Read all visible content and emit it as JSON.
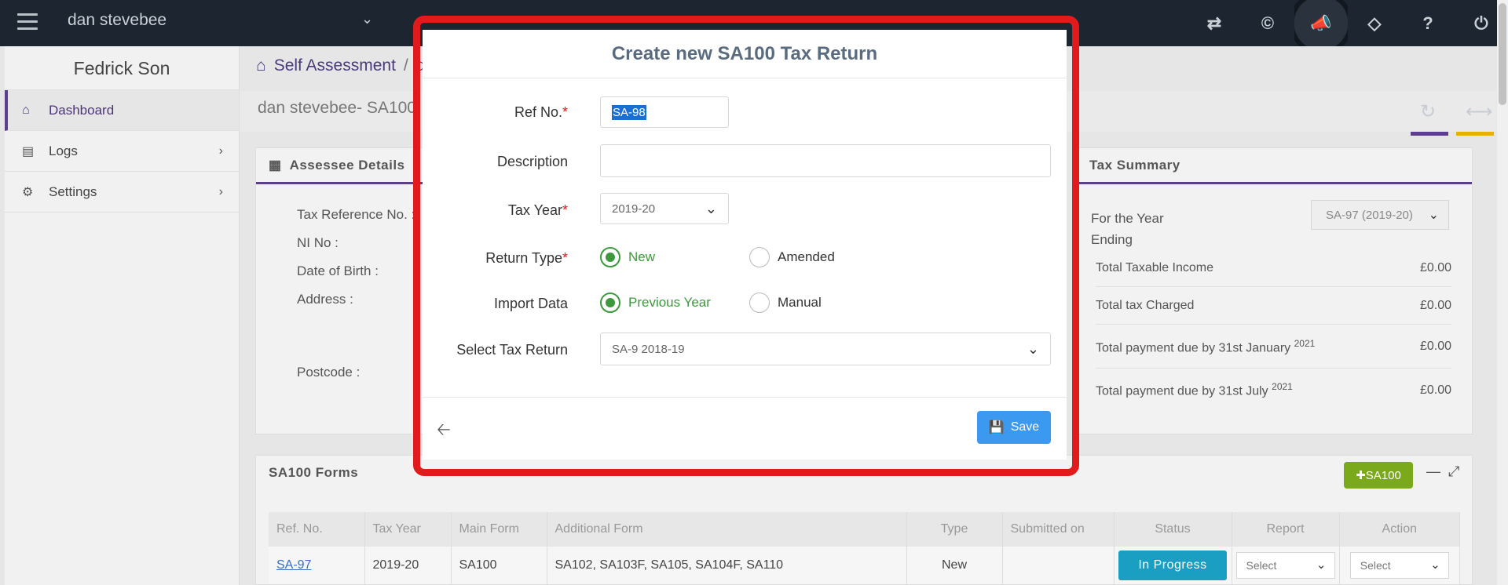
{
  "topbar": {
    "user_name": "dan stevebee",
    "icons": [
      "transfer-icon",
      "copyright-icon",
      "megaphone-icon",
      "ticket-icon",
      "help-icon",
      "power-icon"
    ]
  },
  "sidebar": {
    "title": "Fedrick Son",
    "items": [
      {
        "label": "Dashboard",
        "icon": "home-icon"
      },
      {
        "label": "Logs",
        "icon": "file-icon"
      },
      {
        "label": "Settings",
        "icon": "gear-icon"
      }
    ]
  },
  "breadcrumb": {
    "root": "Self Assessment",
    "sep": "/",
    "current": "d"
  },
  "page": {
    "title": "dan stevebee- SA100"
  },
  "assessee": {
    "title": "Assessee Details",
    "labels": [
      "Tax Reference No. :",
      "NI No :",
      "Date of Birth :",
      "Address :",
      "Postcode :"
    ]
  },
  "tax_summary": {
    "title": "Tax Summary",
    "year_label": "For the Year Ending",
    "selected": "SA-97 (2019-20)",
    "rows": [
      {
        "label": "Total Taxable Income",
        "sup": "",
        "value": "£0.00"
      },
      {
        "label": "Total tax Charged",
        "sup": "",
        "value": "£0.00"
      },
      {
        "label": "Total payment due by 31st January",
        "sup": "2021",
        "value": "£0.00"
      },
      {
        "label": "Total payment due by 31st July",
        "sup": "2021",
        "value": "£0.00"
      }
    ]
  },
  "forms": {
    "title": "SA100 Forms",
    "add_label": "SA100",
    "columns": [
      "Ref. No.",
      "Tax Year",
      "Main Form",
      "Additional Form",
      "Type",
      "Submitted on",
      "Status",
      "Report",
      "Action"
    ],
    "rows": [
      {
        "ref": "SA-97",
        "year": "2019-20",
        "main": "SA100",
        "additional": "SA102, SA103F, SA105, SA104F, SA110",
        "type": "New",
        "submitted": "",
        "status": "In Progress",
        "report": "Select",
        "action": "Select"
      }
    ]
  },
  "modal": {
    "title": "Create new SA100 Tax Return",
    "ref_label": "Ref No.",
    "ref_value": "SA-98",
    "desc_label": "Description",
    "desc_value": "",
    "year_label": "Tax Year",
    "year_value": "2019-20",
    "return_type_label": "Return Type",
    "return_type_options": [
      "New",
      "Amended"
    ],
    "return_type_selected": "New",
    "import_label": "Import Data",
    "import_options": [
      "Previous Year",
      "Manual"
    ],
    "import_selected": "Previous Year",
    "select_return_label": "Select Tax Return",
    "select_return_value": "SA-9 2018-19",
    "required_mark": "*",
    "save_label": "Save"
  },
  "colors": {
    "accent": "#5b3f8c",
    "highlight": "#e11b1b",
    "save": "#3b99f0",
    "status": "#1a9ec2",
    "add": "#7aaa1c"
  }
}
